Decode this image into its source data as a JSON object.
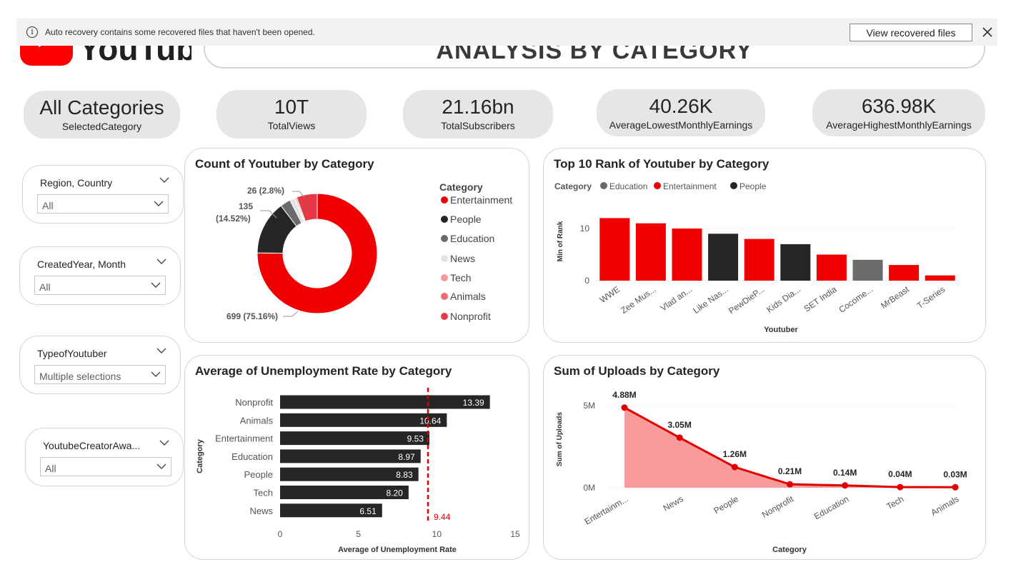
{
  "header": {
    "logo_text": "YouTube",
    "title": "ANALYSIS BY CATEGORY"
  },
  "notification": {
    "message": "Auto recovery contains some recovered files that haven't been opened.",
    "button_label": "View recovered files",
    "info_icon": "info-icon",
    "close_icon": "close-icon"
  },
  "kpis": [
    {
      "value": "All Categories",
      "label": "SelectedCategory"
    },
    {
      "value": "10T",
      "label": "TotalViews"
    },
    {
      "value": "21.16bn",
      "label": "TotalSubscribers"
    },
    {
      "value": "40.26K",
      "label": "AverageLowestMonthlyEarnings"
    },
    {
      "value": "636.98K",
      "label": "AverageHighestMonthlyEarnings"
    }
  ],
  "slicers": [
    {
      "title": "Region, Country",
      "value": "All"
    },
    {
      "title": "CreatedYear, Month",
      "value": "All"
    },
    {
      "title": "TypeofYoutuber",
      "value": "Multiple selections"
    },
    {
      "title": "YoutubeCreatorAwa...",
      "value": "All"
    }
  ],
  "colors": {
    "red": "#f00000",
    "dark": "#262626",
    "gray": "#6b6b6b",
    "light_gray": "#e3e3e3",
    "pink": "#f69898",
    "salmon": "#ee6c73",
    "crimson": "#e63946",
    "area_fill": "#fa9b9b"
  },
  "chart_data": [
    {
      "type": "pie",
      "title": "Count of Youtuber by Category",
      "legend_title": "Category",
      "legend_position": "right",
      "categories": [
        "Entertainment",
        "People",
        "Education",
        "News",
        "Tech",
        "Animals",
        "Nonprofit"
      ],
      "values": [
        699,
        135,
        26,
        12,
        3,
        3,
        52
      ],
      "data_labels": [
        "699 (75.16%)",
        "135",
        "(14.52%)",
        "26 (2.8%)"
      ],
      "colors": [
        "#f00000",
        "#262626",
        "#6b6b6b",
        "#e3e3e3",
        "#f69898",
        "#ee6c73",
        "#e63946"
      ]
    },
    {
      "type": "bar",
      "title": "Top 10 Rank of Youtuber by Category",
      "legend_title": "Category",
      "legend_position": "top-left",
      "legend": [
        "Education",
        "Entertainment",
        "People"
      ],
      "legend_colors": [
        "#6b6b6b",
        "#f00000",
        "#262626"
      ],
      "categories": [
        "WWE",
        "Zee Mus...",
        "Vlad an...",
        "Like Nas...",
        "PewDieP...",
        "Kids Dia...",
        "SET India",
        "Cocome...",
        "MrBeast",
        "T-Series"
      ],
      "values": [
        12,
        11,
        10,
        9,
        8,
        7,
        5,
        4,
        3,
        1
      ],
      "series_category": [
        "Entertainment",
        "Entertainment",
        "Entertainment",
        "People",
        "Entertainment",
        "People",
        "Entertainment",
        "Education",
        "Entertainment",
        "Entertainment"
      ],
      "xlabel": "Youtuber",
      "ylabel": "Min of Rank",
      "yticks": [
        0,
        10
      ],
      "ylim": [
        0,
        13
      ],
      "grid": true
    },
    {
      "type": "bar",
      "orientation": "horizontal",
      "title": "Average of Unemployment Rate by Category",
      "categories": [
        "Nonprofit",
        "Animals",
        "Entertainment",
        "Education",
        "People",
        "Tech",
        "News"
      ],
      "values": [
        13.39,
        10.64,
        9.53,
        8.97,
        8.83,
        8.2,
        6.51
      ],
      "value_labels": [
        "13.39",
        "10.64",
        "9.53",
        "8.97",
        "8.83",
        "8.20",
        "6.51"
      ],
      "xlabel": "Average of Unemployment Rate",
      "ylabel": "Category",
      "xticks": [
        0,
        5,
        10,
        15
      ],
      "xlim": [
        0,
        15
      ],
      "reference_line": {
        "value": 9.44,
        "label": "9.44"
      }
    },
    {
      "type": "area",
      "title": "Sum of Uploads by Category",
      "categories": [
        "Entertainm...",
        "News",
        "People",
        "Nonprofit",
        "Education",
        "Tech",
        "Animals"
      ],
      "values": [
        4.88,
        3.05,
        1.26,
        0.21,
        0.14,
        0.04,
        0.03
      ],
      "value_labels": [
        "4.88M",
        "3.05M",
        "1.26M",
        "0.21M",
        "0.14M",
        "0.04M",
        "0.03M"
      ],
      "xlabel": "Category",
      "ylabel": "Sum of Uploads",
      "ytick_labels": [
        "0M",
        "5M"
      ],
      "yticks": [
        0,
        5
      ],
      "ylim": [
        0,
        5.3
      ],
      "grid": true
    }
  ]
}
